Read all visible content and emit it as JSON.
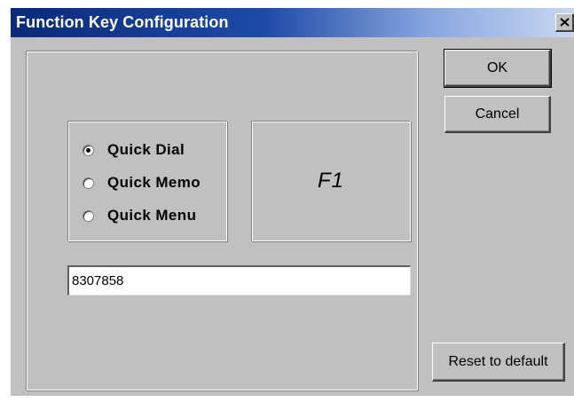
{
  "window": {
    "title": "Function Key Configuration",
    "close_icon": "close-x-icon"
  },
  "mode": {
    "options": [
      {
        "label": "Quick Dial",
        "selected": true
      },
      {
        "label": "Quick Memo",
        "selected": false
      },
      {
        "label": "Quick Menu",
        "selected": false
      }
    ]
  },
  "key": {
    "label": "F1"
  },
  "number_field": {
    "value": "8307858"
  },
  "buttons": {
    "ok": "OK",
    "cancel": "Cancel",
    "reset": "Reset to default"
  },
  "colors": {
    "title_bar_start": "#0a2a7a",
    "title_bar_end": "#c8d6f2",
    "dialog_face": "#c0c0c0"
  }
}
